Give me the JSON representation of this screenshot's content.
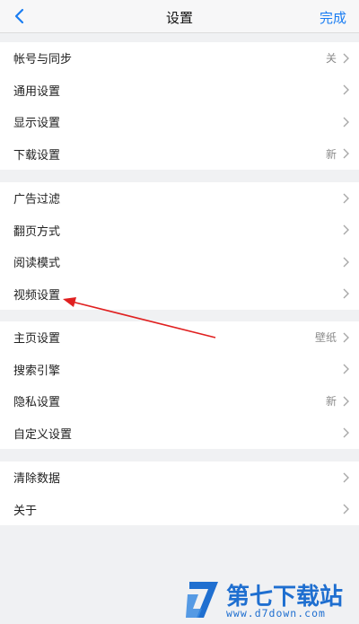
{
  "header": {
    "title": "设置",
    "done_label": "完成"
  },
  "sections": [
    {
      "items": [
        {
          "label": "帐号与同步",
          "value": "关"
        },
        {
          "label": "通用设置",
          "value": ""
        },
        {
          "label": "显示设置",
          "value": ""
        },
        {
          "label": "下载设置",
          "value": "新"
        }
      ]
    },
    {
      "items": [
        {
          "label": "广告过滤",
          "value": ""
        },
        {
          "label": "翻页方式",
          "value": ""
        },
        {
          "label": "阅读模式",
          "value": ""
        },
        {
          "label": "视频设置",
          "value": ""
        }
      ]
    },
    {
      "items": [
        {
          "label": "主页设置",
          "value": "壁纸"
        },
        {
          "label": "搜索引擎",
          "value": ""
        },
        {
          "label": "隐私设置",
          "value": "新"
        },
        {
          "label": "自定义设置",
          "value": ""
        }
      ]
    },
    {
      "items": [
        {
          "label": "清除数据",
          "value": ""
        },
        {
          "label": "关于",
          "value": ""
        }
      ]
    }
  ],
  "watermark": {
    "title": "第七下载站",
    "url": "www.d7down.com"
  },
  "colors": {
    "accent": "#1a7df2",
    "background": "#f0f1f3",
    "annotation_arrow": "#e02020",
    "watermark": "#1f6fd0"
  }
}
